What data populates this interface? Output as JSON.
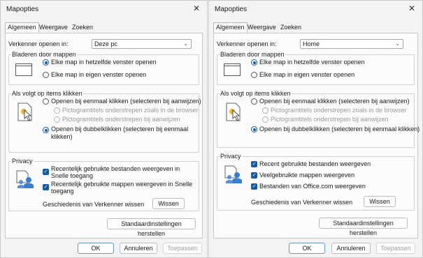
{
  "dialogs": [
    {
      "title": "Mapopties",
      "tabs": [
        "Algemeen",
        "Weergave",
        "Zoeken"
      ],
      "open_in_label": "Verkenner openen in:",
      "open_in_value": "Deze pc",
      "browse_group": "Bladeren door mappen",
      "browse_options": [
        "Elke map in hetzelfde venster openen",
        "Elke map in eigen venster openen"
      ],
      "click_group": "Als volgt op items klikken",
      "click_single": "Openen bij eenmaal klikken (selecteren bij aanwijzen)",
      "click_sub": [
        "Pictogramtitels onderstrepen zoals in de browser",
        "Pictogramtitels onderstrepen bij aanwijzen"
      ],
      "click_double_line1": "Openen bij dubbelklikken (selecteren bij eenmaal",
      "click_double_line2": "klikken)",
      "privacy_group": "Privacy",
      "privacy_items": [
        {
          "line1": "Recentelijk gebruikte bestanden weergeven in",
          "line2": "Snelle toegang"
        },
        {
          "line1": "Recentelijk gebruikte mappen weergeven in Snelle",
          "line2": "toegang"
        }
      ],
      "history_label": "Geschiedenis van Verkenner wissen",
      "clear_button": "Wissen",
      "restore_button": "Standaardinstellingen herstellen",
      "ok": "OK",
      "cancel": "Annuleren",
      "apply": "Toepassen"
    },
    {
      "title": "Mapopties",
      "tabs": [
        "Algemeen",
        "Weergave",
        "Zoeken"
      ],
      "open_in_label": "Verkenner openen in:",
      "open_in_value": "Home",
      "browse_group": "Bladeren door mappen",
      "browse_options": [
        "Elke map in hetzelfde venster openen",
        "Elke map in eigen venster openen"
      ],
      "click_group": "Als volgt op items klikken",
      "click_single": "Openen bij eenmaal klikken (selecteren bij aanwijzen)",
      "click_sub": [
        "Pictogramtitels onderstrepen zoals in de browser",
        "Pictogramtitels onderstrepen bij aanwijzen"
      ],
      "click_double": "Openen bij dubbelklikken (selecteren bij eenmaal klikken)",
      "privacy_group": "Privacy",
      "privacy_items": [
        "Recent gebruikte bestanden weergeven",
        "Veelgebruikte mappen weergeven",
        "Bestanden van Office.com weergeven"
      ],
      "history_label": "Geschiedenis van Verkenner wissen",
      "clear_button": "Wissen",
      "restore_button": "Standaardinstellingen herstellen",
      "ok": "OK",
      "cancel": "Annuleren",
      "apply": "Toepassen"
    }
  ],
  "accent_color": "#0a5cb3",
  "close_glyph": "✕"
}
